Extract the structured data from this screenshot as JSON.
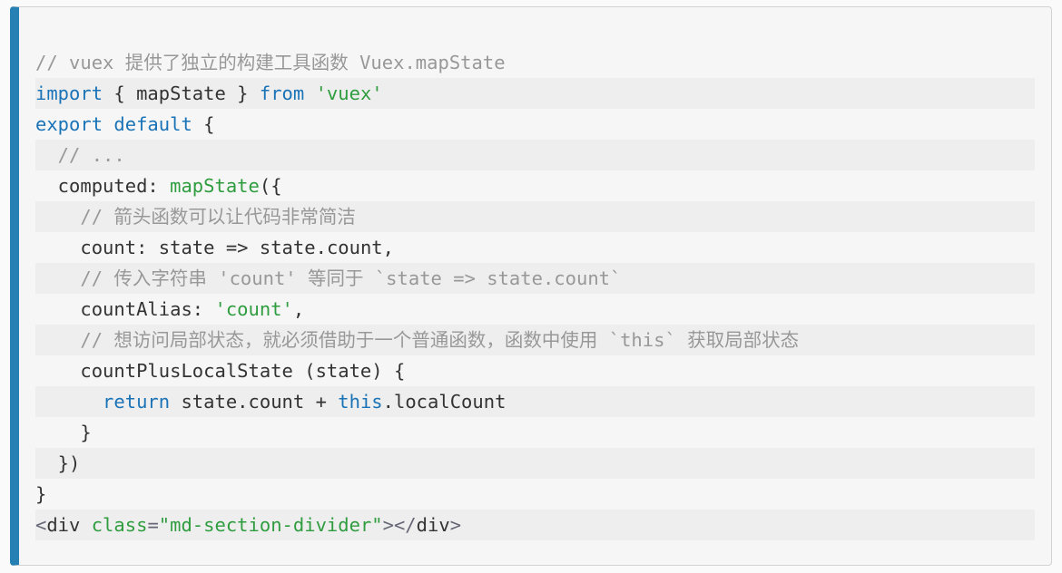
{
  "code": {
    "comment1_a": "// vuex ",
    "comment1_b": "提供了独立的构建工具函数",
    "comment1_c": " Vuex.mapState",
    "import_kw": "import",
    "import_brace_open": " { ",
    "import_name": "mapState",
    "import_brace_close": " } ",
    "from_kw": "from",
    "import_space": " ",
    "import_src": "'vuex'",
    "export_kw": "export",
    "default_kw": " default",
    "obj_open": " {",
    "dots": "  // ...",
    "computed_key": "  computed",
    "colon": ": ",
    "mapstate_fn": "mapState",
    "paren_open": "({",
    "comment2_a": "    // ",
    "comment2_b": "箭头函数可以让代码非常简洁",
    "count_key": "    count",
    "arrow_colon": ": ",
    "state_param": "state",
    "arrow": " => ",
    "state_dot": "state",
    "dot": ".",
    "count_prop": "count",
    "comma": ",",
    "comment3_a": "    // ",
    "comment3_b": "传入字符串 'count' 等同于 `state => state.count`",
    "countAlias_key": "    countAlias",
    "alias_colon": ": ",
    "alias_str": "'count'",
    "comment4_a": "    // ",
    "comment4_b": "想访问局部状态，就必须借助于一个普通函数，函数中使用 `this` 获取局部状态",
    "method_name": "    countPlusLocalState ",
    "method_paren_open": "(",
    "method_param": "state",
    "method_paren_close": ") {",
    "return_kw": "      return",
    "return_space": " ",
    "state2": "state",
    "dot2": ".",
    "count2": "count",
    "plus": " + ",
    "this_kw": "this",
    "dot3": ".",
    "localCount": "localCount",
    "method_close": "    }",
    "map_close": "  })",
    "obj_close": "}",
    "html_open": "<",
    "html_tag": "div",
    "html_space": " ",
    "html_attr": "class",
    "html_eq": "=",
    "html_val": "\"md-section-divider\"",
    "html_close1": ">",
    "html_open2": "</",
    "html_tag2": "div",
    "html_close2": ">"
  }
}
